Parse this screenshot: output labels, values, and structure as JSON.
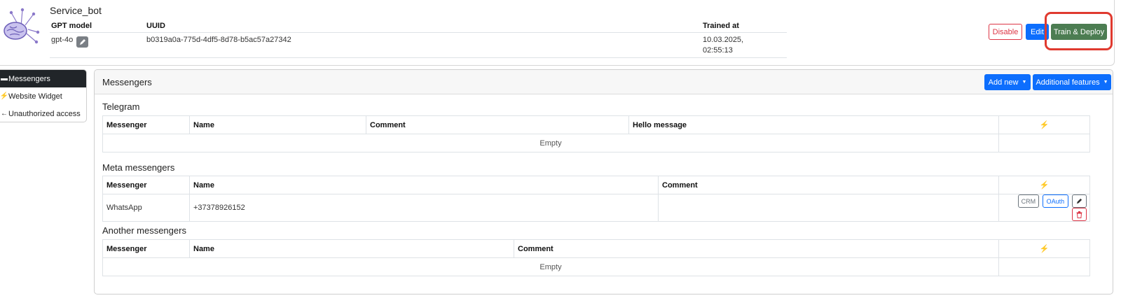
{
  "bot": {
    "name": "Service_bot",
    "columns": {
      "model": "GPT model",
      "uuid": "UUID",
      "trained": "Trained at"
    },
    "model": "gpt-4o",
    "uuid": "b0319a0a-775d-4df5-8d78-b5ac57a27342",
    "trained_date": "10.03.2025,",
    "trained_time": "02:55:13",
    "avatar_icon": "brain-network-icon",
    "actions": {
      "disable": "Disable",
      "edit": "Edit",
      "train_deploy": "Train & Deploy"
    }
  },
  "sidebar": {
    "items": [
      {
        "label": "Messengers",
        "icon": "chat-icon",
        "active": true
      },
      {
        "label": "Website Widget",
        "icon": "bolt-icon",
        "active": false
      },
      {
        "label": "Unauthorized access",
        "icon": "arrow-left-icon",
        "active": false
      }
    ]
  },
  "panel": {
    "title": "Messengers",
    "add_new": "Add new",
    "additional": "Additional features",
    "bolt_glyph": "⚡"
  },
  "telegram": {
    "title": "Telegram",
    "headers": [
      "Messenger",
      "Name",
      "Comment",
      "Hello message"
    ],
    "empty": "Empty"
  },
  "meta": {
    "title": "Meta messengers",
    "headers": [
      "Messenger",
      "Name",
      "Comment"
    ],
    "rows": [
      {
        "messenger": "WhatsApp",
        "name": "+37378926152",
        "comment": ""
      }
    ],
    "row_actions": {
      "crm": "CRM",
      "oauth": "OAuth"
    }
  },
  "another": {
    "title": "Another messengers",
    "headers": [
      "Messenger",
      "Name",
      "Comment"
    ],
    "empty": "Empty"
  },
  "colors": {
    "primary": "#0d6efd",
    "success": "#4c7d52",
    "danger": "#dc3545",
    "highlight": "#e03a2f",
    "dark": "#212529"
  }
}
